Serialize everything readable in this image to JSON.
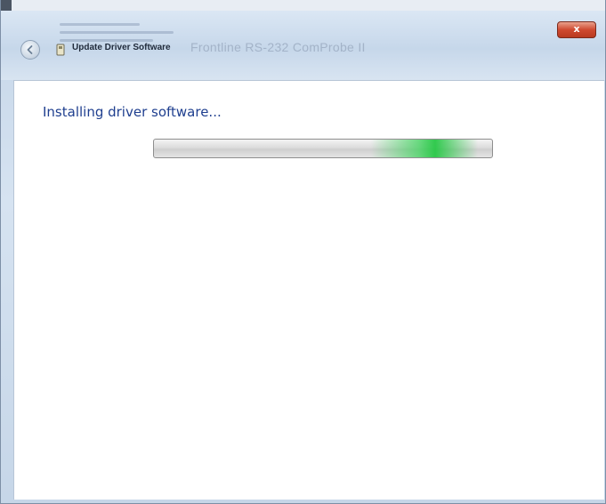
{
  "window": {
    "close_glyph": "x",
    "close_color": "#cf4a30"
  },
  "nav": {
    "back_icon": "back-arrow-icon",
    "wizard_icon": "device-icon",
    "title": "Update Driver Software",
    "device_name": "Frontline RS-232 ComProbe II"
  },
  "main": {
    "heading": "Installing driver software...",
    "progress_state": "indeterminate",
    "progress_glow_position": 0.8,
    "progress_color": "#3cd25a"
  }
}
